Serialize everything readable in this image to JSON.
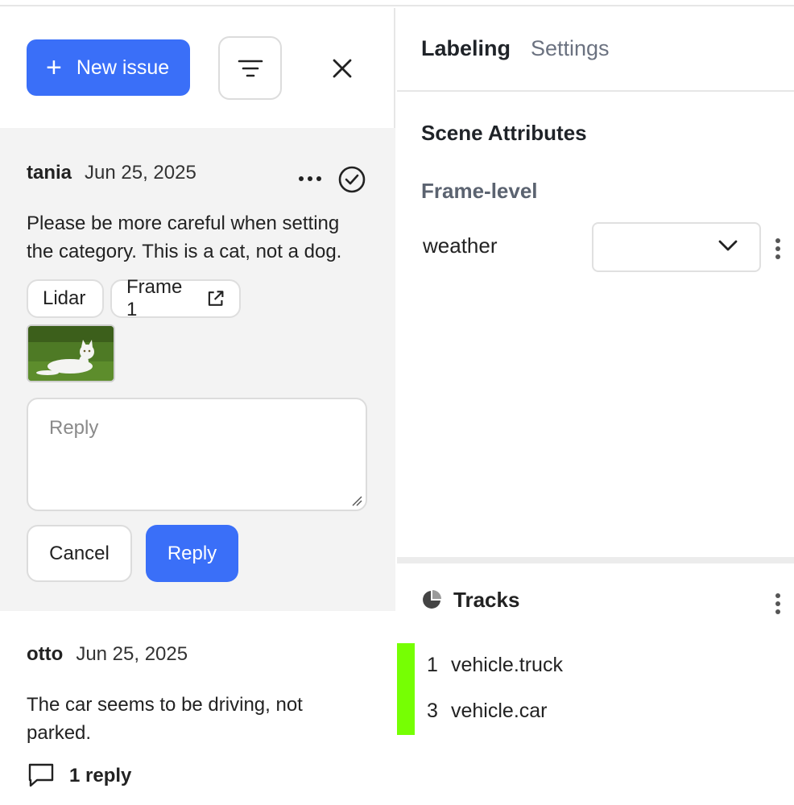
{
  "toolbar": {
    "new_issue_label": "New issue",
    "new_issue_plus": "+"
  },
  "issues": [
    {
      "author": "tania",
      "date": "Jun 25, 2025",
      "text": "Please be more careful when setting the category. This is a cat, not a dog.",
      "chips": [
        "Lidar",
        "Frame 1"
      ],
      "reply_placeholder": "Reply",
      "cancel_label": "Cancel",
      "reply_label": "Reply"
    },
    {
      "author": "otto",
      "date": "Jun 25, 2025",
      "text": "The car seems to be driving, not parked.",
      "replies_label": "1 reply"
    }
  ],
  "right": {
    "tabs": [
      "Labeling",
      "Settings"
    ],
    "section_title": "Scene Attributes",
    "sub_title": "Frame-level",
    "attribute_label": "weather",
    "attribute_value": "",
    "tracks_title": "Tracks",
    "tracks": [
      {
        "id": "1",
        "name": "vehicle.truck",
        "color": "#76ff03"
      },
      {
        "id": "3",
        "name": "vehicle.car",
        "color": "#76ff03"
      }
    ]
  },
  "colors": {
    "accent": "#3a6ff8",
    "active_issue_bg": "#f3f3f3",
    "track_color": "#76ff03"
  },
  "icons": [
    "plus-icon",
    "filter-icon",
    "close-icon",
    "more-horizontal-icon",
    "check-circle-icon",
    "external-link-icon",
    "resize-handle-icon",
    "comment-icon",
    "chevron-down-icon",
    "kebab-icon",
    "pie-chart-icon"
  ]
}
